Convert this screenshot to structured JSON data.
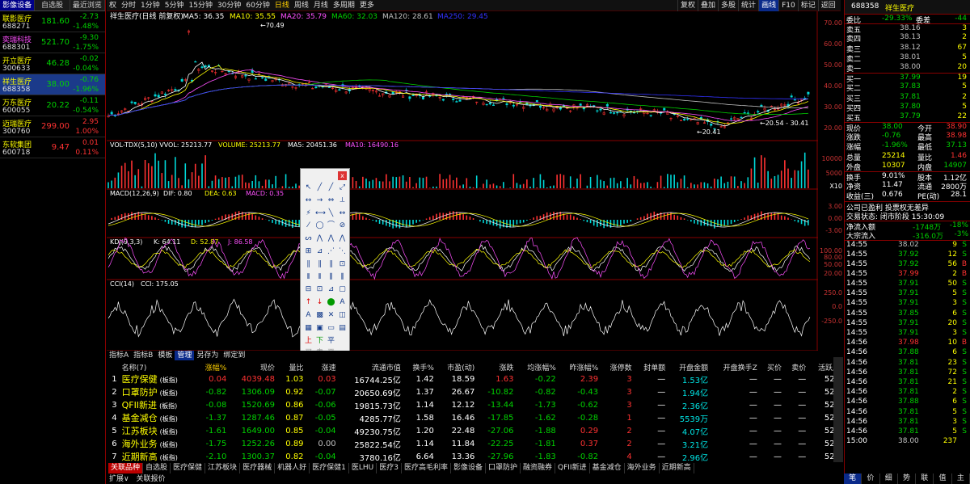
{
  "watchlist": {
    "tabs": [
      "影像设备",
      "自选股",
      "最近浏览"
    ],
    "items": [
      {
        "name": "联影医疗",
        "code": "688271",
        "price": "181.60",
        "change": "-2.73",
        "pct": "-1.48%",
        "dir": "down"
      },
      {
        "name": "奕瑞科技",
        "code": "688301",
        "price": "521.70",
        "change": "-9.30",
        "pct": "-1.75%",
        "dir": "down"
      },
      {
        "name": "开立医疗",
        "code": "300633",
        "price": "46.28",
        "change": "-0.02",
        "pct": "-0.04%",
        "dir": "down"
      },
      {
        "name": "祥生医疗",
        "code": "688358",
        "price": "38.00",
        "change": "-0.76",
        "pct": "-1.96%",
        "dir": "down"
      },
      {
        "name": "万东医疗",
        "code": "600055",
        "price": "20.22",
        "change": "-0.11",
        "pct": "-0.54%",
        "dir": "down"
      },
      {
        "name": "迈瑞医疗",
        "code": "300760",
        "price": "299.00",
        "change": "2.95",
        "pct": "1.00%",
        "dir": "up"
      },
      {
        "name": "东软集团",
        "code": "600718",
        "price": "9.47",
        "change": "0.01",
        "pct": "0.11%",
        "dir": "up"
      }
    ]
  },
  "toolbar": {
    "items": [
      "权",
      "分时",
      "1分钟",
      "5分钟",
      "15分钟",
      "30分钟",
      "60分钟",
      "日线",
      "周线",
      "月线",
      "多周期",
      "更多"
    ],
    "right": [
      "复权",
      "叠加",
      "多股",
      "统计",
      "画线",
      "F10",
      "标记",
      "返回"
    ]
  },
  "chart": {
    "title": "祥生医疗(日线 前复权)",
    "ma": [
      {
        "label": "MA5: 36.35",
        "color": "#ffffff"
      },
      {
        "label": "MA10: 35.55",
        "color": "#ffff00"
      },
      {
        "label": "MA20: 35.79",
        "color": "#ff50ff"
      },
      {
        "label": "MA60: 32.03",
        "color": "#00d200"
      },
      {
        "label": "MA120: 28.61",
        "color": "#c0c0c0"
      },
      {
        "label": "MA250: 29.45",
        "color": "#3232ff"
      }
    ],
    "high_label": "70.49",
    "low_label": "20.41",
    "low2_label": "20.54",
    "mid_label": "30.41",
    "price_axis": [
      "70.00",
      "60.00",
      "50.00",
      "40.00",
      "30.00",
      "20.00"
    ],
    "vol_title": "VOL-TDX(5,10) VVOL: 25213.77",
    "vol_vals": [
      {
        "label": "VOLUME: 25213.77",
        "color": "#ffff00"
      },
      {
        "label": "MA5: 20451.36",
        "color": "#ffffff"
      },
      {
        "label": "MA10: 16490.16",
        "color": "#ff50ff"
      }
    ],
    "vol_axis": [
      "10000",
      "5000"
    ],
    "vol_unit": "X10",
    "macd_title": "MACD(12,26,9)",
    "macd_vals": [
      {
        "label": "DIF: 0.80",
        "color": "#ffffff"
      },
      {
        "label": "DEA: 0.63",
        "color": "#ffff00"
      },
      {
        "label": "MACD: 0.35",
        "color": "#ff50ff"
      }
    ],
    "macd_axis": [
      "3.00",
      "0.00",
      "-3.00"
    ],
    "kdj_title": "KDJ(9,3,3)",
    "kdj_vals": [
      {
        "label": "K: 64.11",
        "color": "#ffffff"
      },
      {
        "label": "D: 52.87",
        "color": "#ffff00"
      },
      {
        "label": "J: 86.58",
        "color": "#ff50ff"
      }
    ],
    "kdj_axis": [
      "100.00",
      "80.00",
      "50.00",
      "20.00"
    ],
    "cci_title": "CCI(14)",
    "cci_vals": [
      {
        "label": "CCI: 175.05",
        "color": "#ffffff"
      }
    ],
    "cci_axis": [
      "250.0",
      "0.0",
      "-250.0"
    ],
    "years": [
      {
        "label": "2019年",
        "color": "#c83232"
      },
      {
        "label": "2",
        "color": "#c83232"
      },
      {
        "label": "3",
        "color": "#c83232"
      },
      {
        "label": "4",
        "color": "#c83232"
      },
      {
        "label": "5",
        "color": "#c83232"
      },
      {
        "label": "6",
        "color": "#c83232"
      },
      {
        "label": "7",
        "color": "#c83232"
      },
      {
        "label": "8",
        "color": "#c83232"
      },
      {
        "label": "9",
        "color": "#c83232"
      },
      {
        "label": "10",
        "color": "#c83232"
      },
      {
        "label": "11",
        "color": "#c83232"
      },
      {
        "label": "12",
        "color": "#c83232"
      },
      {
        "label": "2",
        "color": "#c83232"
      },
      {
        "label": "3",
        "color": "#c83232"
      },
      {
        "label": "4",
        "color": "#c83232"
      },
      {
        "label": "5",
        "color": "#c83232"
      },
      {
        "label": "6",
        "color": "#c83232"
      },
      {
        "label": "7",
        "color": "#c83232"
      },
      {
        "label": "8",
        "color": "#c83232"
      },
      {
        "label": "9",
        "color": "#c83232"
      }
    ],
    "date_cursor": "2021/10/18/一",
    "years_right": [
      "1",
      "2",
      "3",
      "4",
      "5",
      "6",
      "7",
      "8",
      "9"
    ],
    "period_label": "日线"
  },
  "draw_tools": [
    "↖",
    "╱",
    "╱",
    "⤢",
    "↔",
    "→",
    "⇔",
    "⟂",
    "⚡",
    "⟷",
    "╲",
    "↔",
    "⁄",
    "◯",
    "⌒",
    "⊘",
    "ᔕ",
    "⋀",
    "⋀",
    "⋀",
    "⊞",
    "⊿",
    "⋰",
    "⋱",
    "∥",
    "∥",
    "∥",
    "⊡",
    "⫴",
    "⫴",
    "⫼",
    "⫼",
    "⊟",
    "⊡",
    "⊿",
    "▢",
    "↑",
    "↓",
    "⬤",
    "A",
    "A",
    "▩",
    "✕",
    "◫",
    "▦",
    "▣",
    "▭",
    "▤",
    "上",
    "下",
    "平",
    "",
    "买",
    "卖",
    "平"
  ],
  "quote": {
    "header_code": "688358",
    "header_name": "祥生医疗",
    "top": [
      [
        "委比",
        "-29.33%",
        "委差",
        "-44"
      ]
    ],
    "ask": [
      [
        "卖五",
        "38.16",
        "3"
      ],
      [
        "卖四",
        "38.13",
        "2"
      ],
      [
        "卖三",
        "38.12",
        "67"
      ],
      [
        "卖二",
        "38.01",
        "5"
      ],
      [
        "卖一",
        "38.00",
        "20"
      ]
    ],
    "bid": [
      [
        "买一",
        "37.99",
        "19"
      ],
      [
        "买二",
        "37.83",
        "5"
      ],
      [
        "买三",
        "37.81",
        "2"
      ],
      [
        "买四",
        "37.80",
        "5"
      ],
      [
        "买五",
        "37.79",
        "22"
      ]
    ],
    "stats": [
      [
        "现价",
        "38.00",
        "今开",
        "38.90"
      ],
      [
        "涨跌",
        "-0.76",
        "最高",
        "38.98"
      ],
      [
        "涨幅",
        "-1.96%",
        "最低",
        "37.13"
      ],
      [
        "总量",
        "25214",
        "量比",
        "1.46"
      ],
      [
        "外盘",
        "10307",
        "内盘",
        "14907"
      ]
    ],
    "stats2": [
      [
        "换手",
        "9.01%",
        "股本",
        "1.12亿"
      ],
      [
        "净资",
        "11.47",
        "流通",
        "2800万"
      ],
      [
        "收益(三)",
        "0.676",
        "PE(动)",
        "28.1"
      ]
    ],
    "notice": "公司已盈利 投票权无差异",
    "trade_state": "交易状态: 闭市阶段 15:30:09",
    "flow": [
      [
        "净流入额",
        "-1748万",
        "-18%"
      ],
      [
        "大宗流入",
        "-316.0万",
        "-3%"
      ]
    ],
    "ticks": [
      [
        "14:55",
        "38.02",
        "9",
        "S"
      ],
      [
        "14:55",
        "37.92",
        "12",
        "S"
      ],
      [
        "14:55",
        "37.92",
        "56",
        "B"
      ],
      [
        "14:55",
        "37.99",
        "2",
        "B"
      ],
      [
        "14:55",
        "37.91",
        "50",
        "S"
      ],
      [
        "14:55",
        "37.91",
        "5",
        "S"
      ],
      [
        "14:55",
        "37.91",
        "3",
        "S"
      ],
      [
        "14:55",
        "37.85",
        "6",
        "S"
      ],
      [
        "14:55",
        "37.91",
        "20",
        "S"
      ],
      [
        "14:55",
        "37.91",
        "3",
        "S"
      ],
      [
        "14:56",
        "37.98",
        "10",
        "B"
      ],
      [
        "14:56",
        "37.88",
        "6",
        "S"
      ],
      [
        "14:56",
        "37.81",
        "23",
        "S"
      ],
      [
        "14:56",
        "37.81",
        "72",
        "S"
      ],
      [
        "14:56",
        "37.81",
        "21",
        "S"
      ],
      [
        "14:56",
        "37.81",
        "2",
        "S"
      ],
      [
        "14:56",
        "37.88",
        "6",
        "S"
      ],
      [
        "14:56",
        "37.81",
        "5",
        "S"
      ],
      [
        "14:56",
        "37.81",
        "3",
        "S"
      ],
      [
        "14:56",
        "37.81",
        "5",
        "S"
      ],
      [
        "15:00",
        "38.00",
        "237",
        ""
      ]
    ],
    "bottom_tabs": [
      "笔",
      "价",
      "细",
      "势",
      "联",
      "值",
      "主"
    ]
  },
  "list": {
    "subtabs": [
      "指标A",
      "指标B",
      "模板",
      "管理",
      "另存为",
      "绑定到"
    ],
    "headers": [
      "",
      "名称(7)",
      "涨幅%",
      "现价",
      "量比",
      "涨速",
      "流通市值",
      "换手%",
      "市盈(动)",
      "涨跌",
      "均涨幅%",
      "昨涨幅%",
      "涨停数",
      "封单额",
      "开盘金额",
      "开盘换手Z",
      "买价",
      "卖价",
      "活跃度"
    ],
    "rows": [
      [
        "1",
        "医疗保健",
        "(板指)",
        "0.04",
        "4039.48",
        "1.03",
        "0.03",
        "16744.25亿",
        "1.42",
        "18.59",
        "1.63",
        "-0.22",
        "2.39",
        "3",
        "—",
        "1.53亿",
        "—",
        "—",
        "—",
        "528"
      ],
      [
        "2",
        "口罩防护",
        "(板指)",
        "-0.82",
        "1306.09",
        "0.92",
        "-0.07",
        "20650.69亿",
        "1.37",
        "26.67",
        "-10.82",
        "-0.82",
        "-0.43",
        "3",
        "—",
        "1.94亿",
        "—",
        "—",
        "—",
        "528"
      ],
      [
        "3",
        "QFII新进",
        "(板指)",
        "-0.08",
        "1520.69",
        "0.86",
        "-0.06",
        "19815.73亿",
        "1.14",
        "12.12",
        "-13.44",
        "-1.73",
        "-0.62",
        "3",
        "—",
        "2.36亿",
        "—",
        "—",
        "—",
        "528"
      ],
      [
        "4",
        "基金减仓",
        "(板指)",
        "-1.37",
        "1287.46",
        "0.87",
        "-0.05",
        "4285.77亿",
        "1.58",
        "16.46",
        "-17.85",
        "-1.62",
        "-0.28",
        "1",
        "—",
        "5539万",
        "—",
        "—",
        "—",
        "527"
      ],
      [
        "5",
        "江苏板块",
        "(板指)",
        "-1.61",
        "1649.00",
        "0.85",
        "-0.04",
        "49230.75亿",
        "1.20",
        "22.48",
        "-27.06",
        "-1.88",
        "0.29",
        "2",
        "—",
        "4.07亿",
        "—",
        "—",
        "—",
        "528"
      ],
      [
        "6",
        "海外业务",
        "(板指)",
        "-1.75",
        "1252.26",
        "0.89",
        "0.00",
        "25822.54亿",
        "1.14",
        "11.84",
        "-22.25",
        "-1.81",
        "0.37",
        "2",
        "—",
        "3.21亿",
        "—",
        "—",
        "—",
        "528"
      ],
      [
        "7",
        "近期新高",
        "(板指)",
        "-2.10",
        "1300.37",
        "0.82",
        "-0.04",
        "3780.16亿",
        "6.64",
        "13.36",
        "-27.96",
        "-1.83",
        "-0.82",
        "4",
        "—",
        "2.96亿",
        "—",
        "—",
        "—",
        "528"
      ]
    ]
  },
  "blocktabs": [
    "关联品种",
    "自选股",
    "医疗保健",
    "江苏板块",
    "医疗器械",
    "机器人好",
    "医疗保健1",
    "医LHU",
    "医疗3",
    "医疗高毛利率",
    "影像设备",
    "口罩防护",
    "融资融券",
    "QFII新进",
    "基金减仓",
    "海外业务",
    "近期新高"
  ],
  "status": [
    "扩展∨",
    "关联报价"
  ]
}
